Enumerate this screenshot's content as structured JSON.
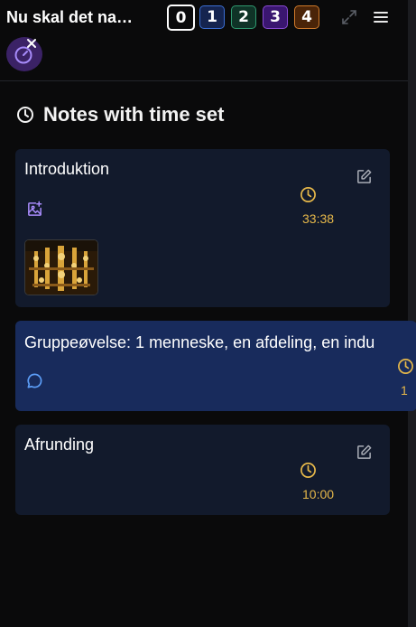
{
  "header": {
    "title": "Nu skal det na…",
    "levels": [
      {
        "label": "0",
        "border": "#ffffff",
        "bg": "#0a0a0b"
      },
      {
        "label": "1",
        "border": "#3b6fd4",
        "bg": "#15244f"
      },
      {
        "label": "2",
        "border": "#2f9a70",
        "bg": "#0f3327"
      },
      {
        "label": "3",
        "border": "#8b4bd6",
        "bg": "#3a1670"
      },
      {
        "label": "4",
        "border": "#d07a2a",
        "bg": "#4a2408"
      }
    ]
  },
  "section": {
    "title": "Notes with time set"
  },
  "notes": [
    {
      "title": "Introduktion",
      "time": "33:38"
    },
    {
      "title": "Gruppeøvelse: 1 menneske, en afdeling, en indu",
      "time": "1"
    },
    {
      "title": "Afrunding",
      "time": "10:00"
    }
  ],
  "colors": {
    "accent_time": "#e6b84a",
    "accent_purple": "#a78bfa",
    "accent_blue": "#5b9cf5",
    "card_bg": "#121a2c",
    "card_active_bg": "#182b5c"
  }
}
